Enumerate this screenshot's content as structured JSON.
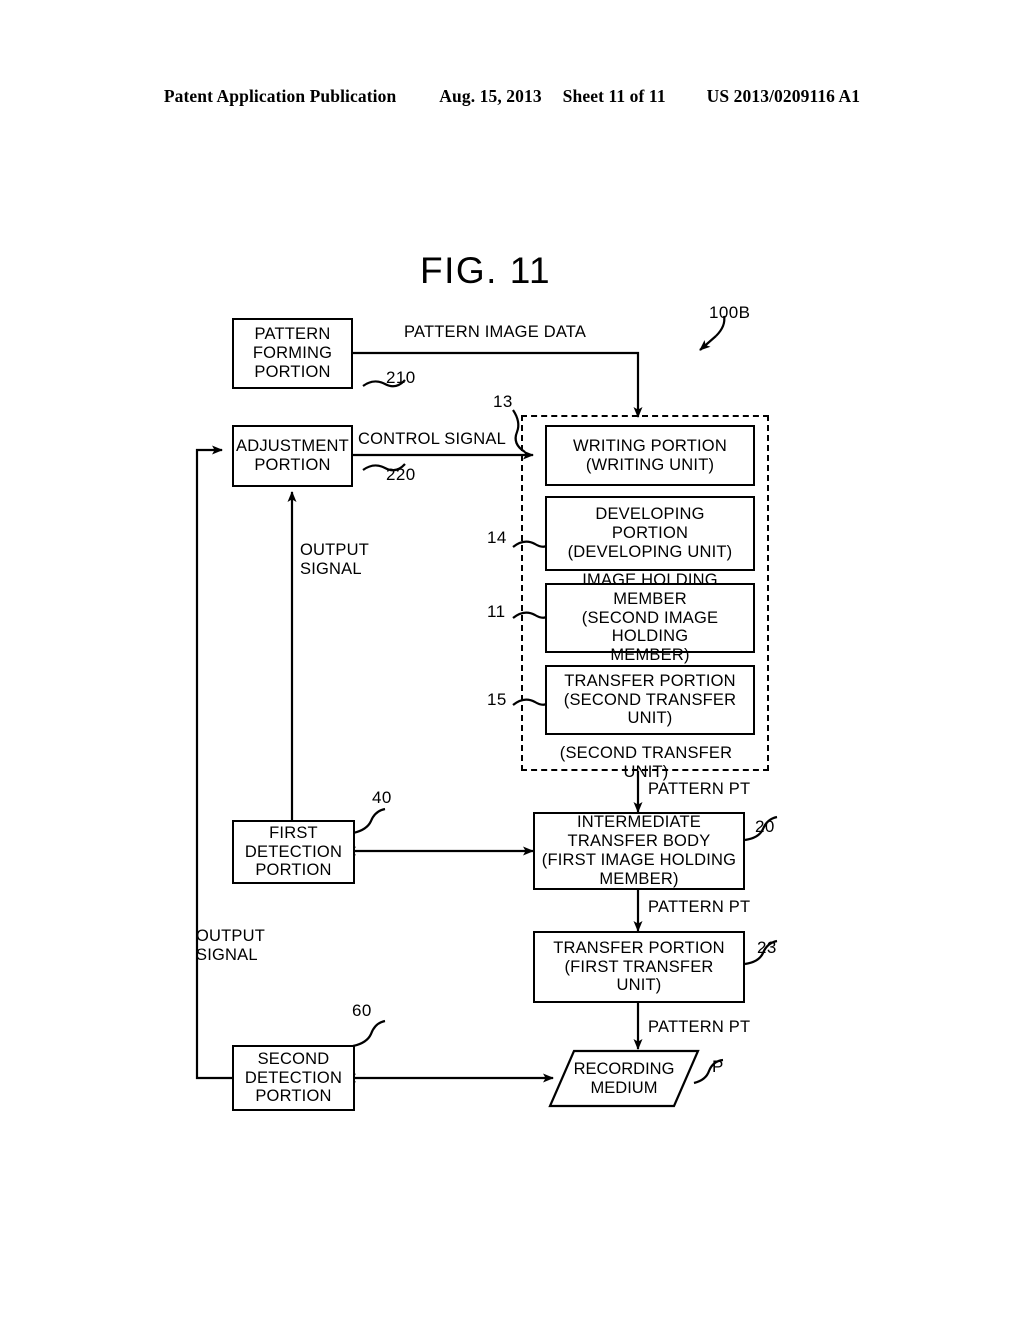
{
  "header": {
    "publication": "Patent Application Publication",
    "date": "Aug. 15, 2013",
    "sheet": "Sheet 11 of 11",
    "patent_number": "US 2013/0209116 A1"
  },
  "figure": {
    "title": "FIG. 11",
    "system_ref": "100B"
  },
  "nodes": {
    "pattern_forming": {
      "label": "PATTERN\nFORMING\nPORTION",
      "ref": "210"
    },
    "adjustment": {
      "label": "ADJUSTMENT\nPORTION",
      "ref": "220"
    },
    "writing": {
      "label": "WRITING PORTION\n(WRITING UNIT)",
      "ref": "13"
    },
    "developing": {
      "label": "DEVELOPING\nPORTION\n(DEVELOPING UNIT)",
      "ref": "14"
    },
    "image_holding": {
      "label": "IMAGE HOLDING MEMBER\n(SECOND IMAGE HOLDING\nMEMBER)",
      "ref": "11"
    },
    "transfer_second": {
      "label": "TRANSFER PORTION\n(SECOND TRANSFER\nUNIT)",
      "ref": "15"
    },
    "intermediate_transfer": {
      "label": "INTERMEDIATE\nTRANSFER BODY\n(FIRST IMAGE HOLDING\nMEMBER)",
      "ref": "20"
    },
    "transfer_first": {
      "label": "TRANSFER PORTION\n(FIRST TRANSFER\nUNIT)",
      "ref": "23"
    },
    "recording_medium": {
      "label": "RECORDING\nMEDIUM",
      "ref": "P"
    },
    "first_detection": {
      "label": "FIRST\nDETECTION\nPORTION",
      "ref": "40"
    },
    "second_detection": {
      "label": "SECOND\nDETECTION\nPORTION",
      "ref": "60"
    }
  },
  "group_label": "(SECOND TRANSFER UNIT)",
  "edge_labels": {
    "pattern_image_data": "PATTERN IMAGE DATA",
    "control_signal": "CONTROL SIGNAL",
    "output_signal_upper": "OUTPUT\nSIGNAL",
    "output_signal_lower": "OUTPUT\nSIGNAL",
    "pattern_pt_1": "PATTERN PT",
    "pattern_pt_2": "PATTERN PT",
    "pattern_pt_3": "PATTERN PT"
  },
  "colors": {
    "ink": "#000000",
    "paper": "#ffffff"
  }
}
